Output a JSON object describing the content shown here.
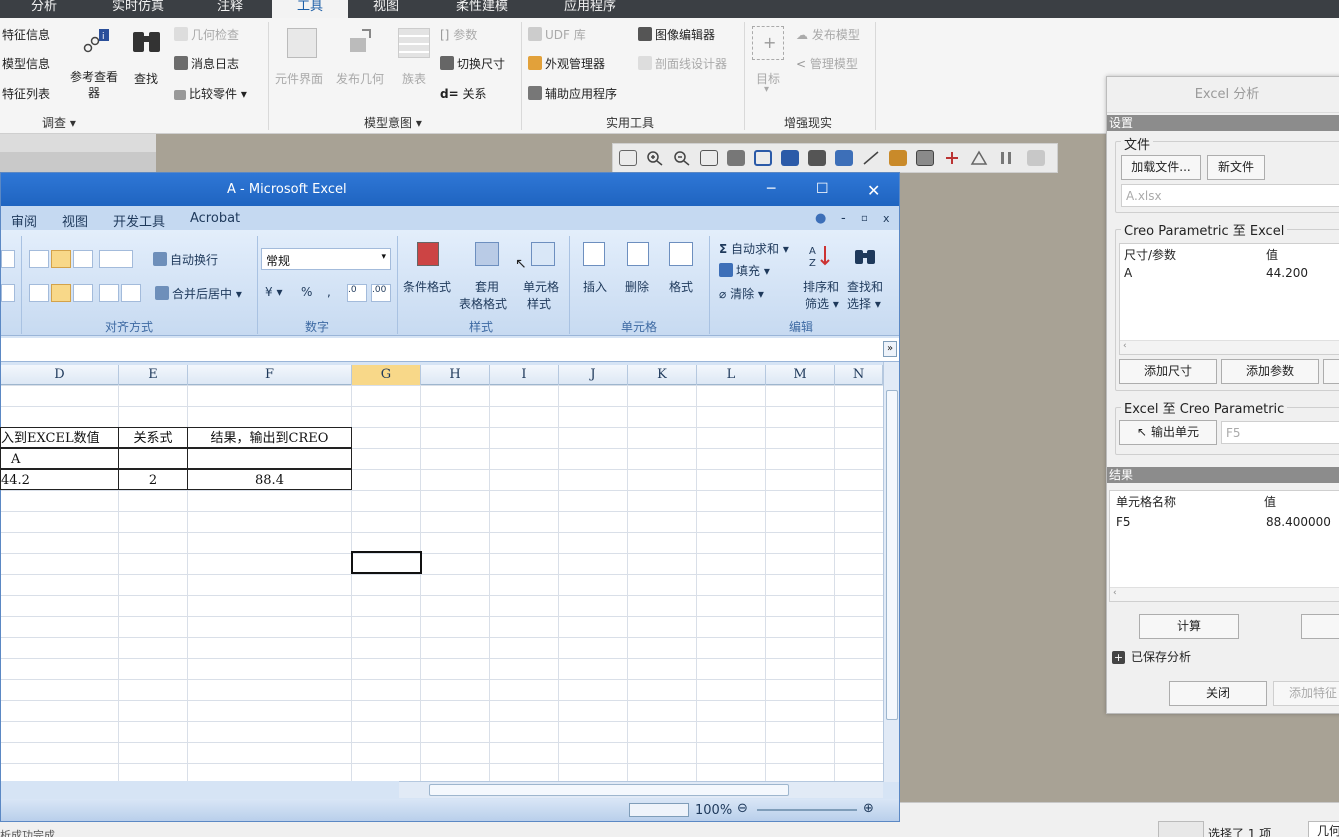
{
  "creo": {
    "tabs": [
      "分析",
      "实时仿真",
      "注释",
      "工具",
      "视图",
      "柔性建模",
      "应用程序"
    ],
    "ribbon": {
      "investigate": {
        "feature_info": "特征信息",
        "model_info": "模型信息",
        "feature_list": "特征列表",
        "ref_viewer": "参考查看器",
        "find": "查找",
        "geometry_check": "几何检查",
        "message_log": "消息日志",
        "compare_part": "比较零件",
        "group_label": "调查"
      },
      "model_intent": {
        "component_interface": "元件界面",
        "publish_geometry": "发布几何",
        "family_table": "族表",
        "parameters": "参数",
        "switch_dimensions": "切换尺寸",
        "relations": "关系",
        "group_label": "模型意图"
      },
      "utilities": {
        "udf_library": "UDF 库",
        "appearance_manager": "外观管理器",
        "auxiliary_app": "辅助应用程序",
        "image_editor": "图像编辑器",
        "section_line_designer": "剖面线设计器",
        "group_label": "实用工具"
      },
      "ar": {
        "target": "目标",
        "publish_model": "发布模型",
        "manage_model": "管理模型",
        "group_label": "增强现实"
      }
    },
    "status_text": "选择了 1 项",
    "status_filter": "几何",
    "status_left": "析成功完成"
  },
  "excel": {
    "title": "A - Microsoft Excel",
    "menu": [
      "审阅",
      "视图",
      "开发工具",
      "Acrobat"
    ],
    "ribbon": {
      "wrap_text": "自动换行",
      "merge_center": "合并后居中",
      "alignment_label": "对齐方式",
      "number_format": "常规",
      "number_label": "数字",
      "conditional_format": "条件格式",
      "format_as_table_1": "套用",
      "format_as_table_2": "表格格式",
      "cell_styles_1": "单元格",
      "cell_styles_2": "样式",
      "styles_label": "样式",
      "insert": "插入",
      "delete": "删除",
      "format": "格式",
      "cells_label": "单元格",
      "autosum": "自动求和",
      "fill": "填充",
      "clear": "清除",
      "sort_filter_1": "排序和",
      "sort_filter_2": "筛选",
      "find_select_1": "查找和",
      "find_select_2": "选择",
      "editing_label": "编辑"
    },
    "columns": [
      "D",
      "E",
      "F",
      "G",
      "H",
      "I",
      "J",
      "K",
      "L",
      "M",
      "N"
    ],
    "cells": {
      "d3": "入到EXCEL数值",
      "e3": "关系式",
      "f3": "结果，输出到CREO",
      "d4": "A",
      "d5": "44.2",
      "e5": "2",
      "f5": "88.4"
    },
    "zoom": "100%"
  },
  "panel": {
    "title": "Excel 分析",
    "settings": "设置",
    "file_legend": "文件",
    "load_file": "加载文件...",
    "new_file": "新文件",
    "file_name": "A.xlsx",
    "creo_to_excel": "Creo Parametric 至 Excel",
    "col_dim_param": "尺寸/参数",
    "col_value": "值",
    "row_name": "A",
    "row_value": "44.200",
    "add_dimension": "添加尺寸",
    "add_parameter": "添加参数",
    "excel_to_creo": "Excel 至 Creo Parametric",
    "output_cells": "输出单元",
    "output_cell_value": "F5",
    "results": "结果",
    "col_cell_name": "单元格名称",
    "col_result_value": "值",
    "result_cell": "F5",
    "result_value": "88.400000",
    "compute": "计算",
    "saved_analysis": "已保存分析",
    "close": "关闭",
    "add_feature": "添加特征"
  }
}
